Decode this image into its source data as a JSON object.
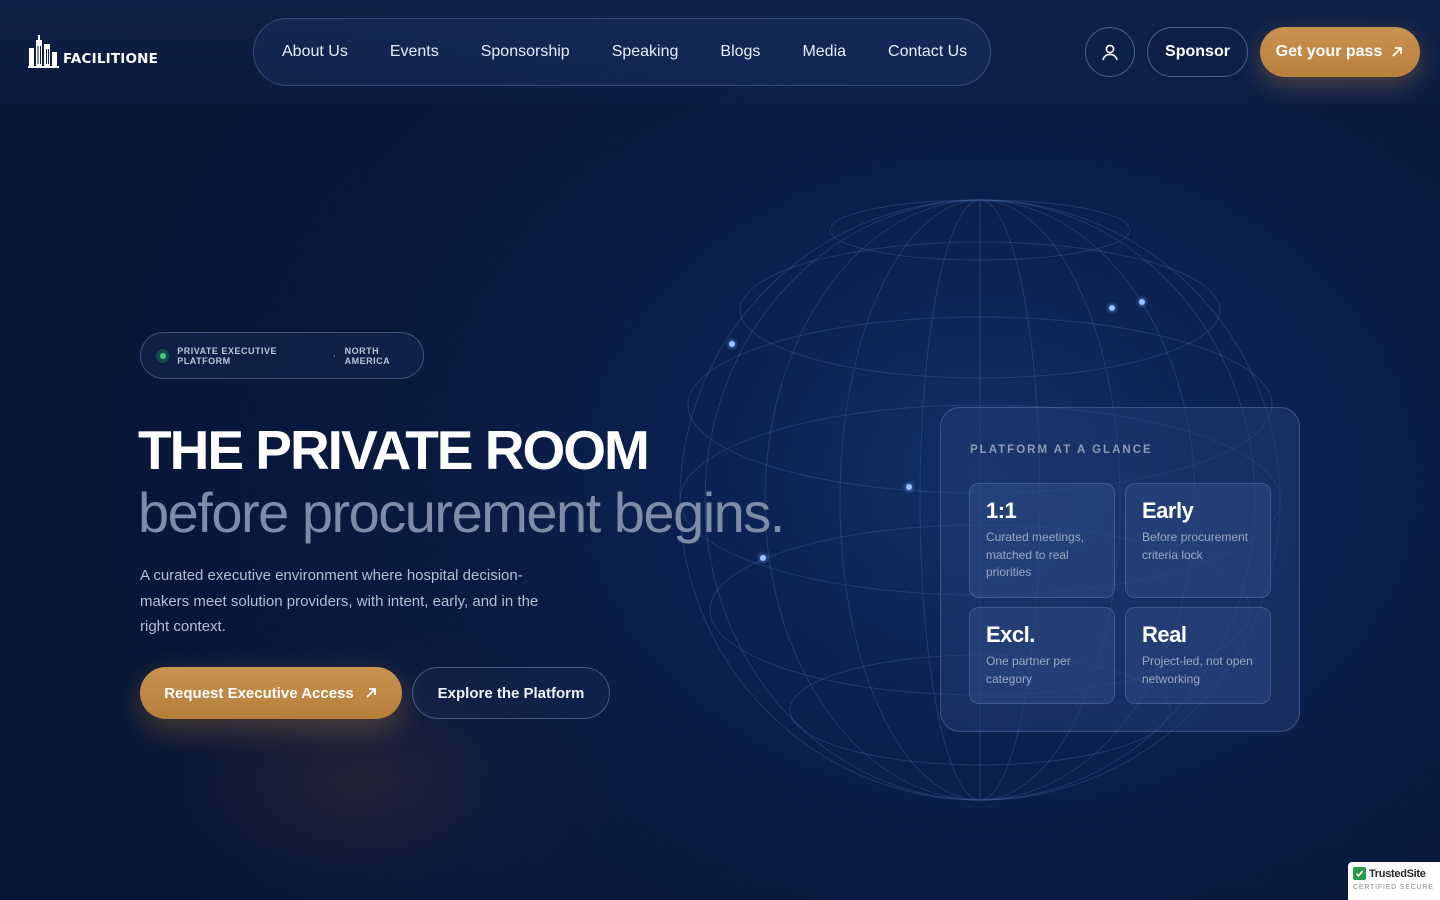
{
  "brand": {
    "name": "FACILITIONE"
  },
  "nav": {
    "items": [
      "About Us",
      "Events",
      "Sponsorship",
      "Speaking",
      "Blogs",
      "Media",
      "Contact Us"
    ]
  },
  "header_actions": {
    "sponsor_label": "Sponsor",
    "pass_label": "Get your pass"
  },
  "hero": {
    "badge": {
      "left": "PRIVATE EXECUTIVE PLATFORM",
      "separator": "·",
      "right": "NORTH AMERICA"
    },
    "title": "THE PRIVATE ROOM",
    "subtitle": "before procurement begins.",
    "lead": "A curated executive environment where hospital decision-makers meet solution providers, with intent, early, and in the right context.",
    "primary_cta": "Request Executive Access",
    "secondary_cta": "Explore the Platform"
  },
  "glance": {
    "title": "PLATFORM AT A GLANCE",
    "stats": [
      {
        "value": "1:1",
        "desc": "Curated meetings, matched to real priorities"
      },
      {
        "value": "Early",
        "desc": "Before procurement criteria lock"
      },
      {
        "value": "Excl.",
        "desc": "One partner per category"
      },
      {
        "value": "Real",
        "desc": "Project-led, not open networking"
      }
    ]
  },
  "trust_seal": {
    "name": "TrustedSite",
    "sub": "CERTIFIED SECURE"
  },
  "colors": {
    "accent": "#c08a47",
    "background": "#0b1f4a",
    "muted_heading": "#7e8ca9"
  }
}
